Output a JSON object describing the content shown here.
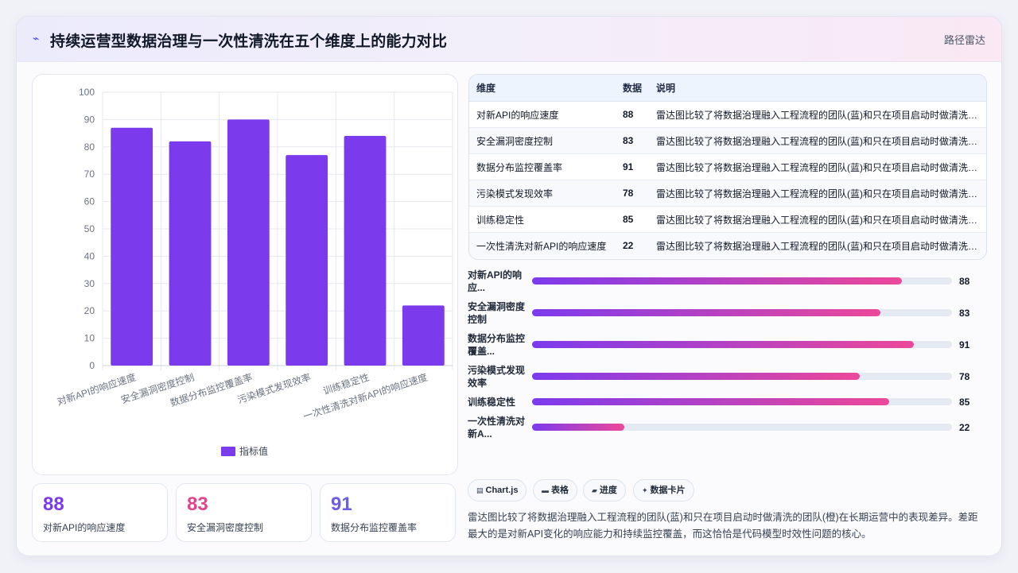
{
  "header": {
    "title": "持续运营型数据治理与一次性清洗在五个维度上的能力对比",
    "tag": "路径雷达",
    "icon": "sparkle-icon"
  },
  "chart_data": {
    "type": "bar",
    "categories": [
      "对新API的响应速度",
      "安全漏洞密度控制",
      "数据分布监控覆盖率",
      "污染模式发现效率",
      "训练稳定性",
      "一次性清洗对新API的响应速度"
    ],
    "series": [
      {
        "name": "指标值",
        "values": [
          87,
          82,
          90,
          77,
          84,
          22
        ]
      }
    ],
    "ylim": [
      0,
      100
    ],
    "yticks": [
      0,
      10,
      20,
      30,
      40,
      50,
      60,
      70,
      80,
      90,
      100
    ],
    "grid": true,
    "legend": "bottom",
    "bar_color": "#7c3aed"
  },
  "stats": [
    {
      "value": "88",
      "label": "对新API的响应速度",
      "color": "#7c3aed"
    },
    {
      "value": "83",
      "label": "安全漏洞密度控制",
      "color": "#e0458b"
    },
    {
      "value": "91",
      "label": "数据分布监控覆盖率",
      "color": "#6d5ce8"
    }
  ],
  "table": {
    "headers": [
      "维度",
      "数据",
      "说明"
    ],
    "rows": [
      [
        "对新API的响应速度",
        "88",
        "雷达图比较了将数据治理融入工程流程的团队(蓝)和只在项目启动时做清洗的团队(橙)在长期运营中的表现差异。"
      ],
      [
        "安全漏洞密度控制",
        "83",
        "雷达图比较了将数据治理融入工程流程的团队(蓝)和只在项目启动时做清洗的团队(橙)在长期运营中的表现差异。"
      ],
      [
        "数据分布监控覆盖率",
        "91",
        "雷达图比较了将数据治理融入工程流程的团队(蓝)和只在项目启动时做清洗的团队(橙)在长期运营中的表现差异。"
      ],
      [
        "污染模式发现效率",
        "78",
        "雷达图比较了将数据治理融入工程流程的团队(蓝)和只在项目启动时做清洗的团队(橙)在长期运营中的表现差异。"
      ],
      [
        "训练稳定性",
        "85",
        "雷达图比较了将数据治理融入工程流程的团队(蓝)和只在项目启动时做清洗的团队(橙)在长期运营中的表现差异。"
      ],
      [
        "一次性清洗对新API的响应速度",
        "22",
        "雷达图比较了将数据治理融入工程流程的团队(蓝)和只在项目启动时做清洗的团队(橙)在长期运营中的表现差异。"
      ]
    ]
  },
  "progress": [
    {
      "label": "对新API的响应...",
      "value": "88",
      "percent": 88
    },
    {
      "label": "安全漏洞密度控制",
      "value": "83",
      "percent": 83
    },
    {
      "label": "数据分布监控覆盖...",
      "value": "91",
      "percent": 91
    },
    {
      "label": "污染模式发现效率",
      "value": "78",
      "percent": 78
    },
    {
      "label": "训练稳定性",
      "value": "85",
      "percent": 85
    },
    {
      "label": "一次性清洗对新A...",
      "value": "22",
      "percent": 22
    }
  ],
  "chips": [
    {
      "icon": "chart-icon",
      "glyph": "▤",
      "label": "Chart.js"
    },
    {
      "icon": "table-icon",
      "glyph": "▬",
      "label": "表格"
    },
    {
      "icon": "progress-icon",
      "glyph": "▰",
      "label": "进度"
    },
    {
      "icon": "card-icon",
      "glyph": "✦",
      "label": "数据卡片"
    }
  ],
  "description": "雷达图比较了将数据治理融入工程流程的团队(蓝)和只在项目启动时做清洗的团队(橙)在长期运营中的表现差异。差距最大的是对新API变化的响应能力和持续监控覆盖，而这恰恰是代码模型时效性问题的核心。"
}
